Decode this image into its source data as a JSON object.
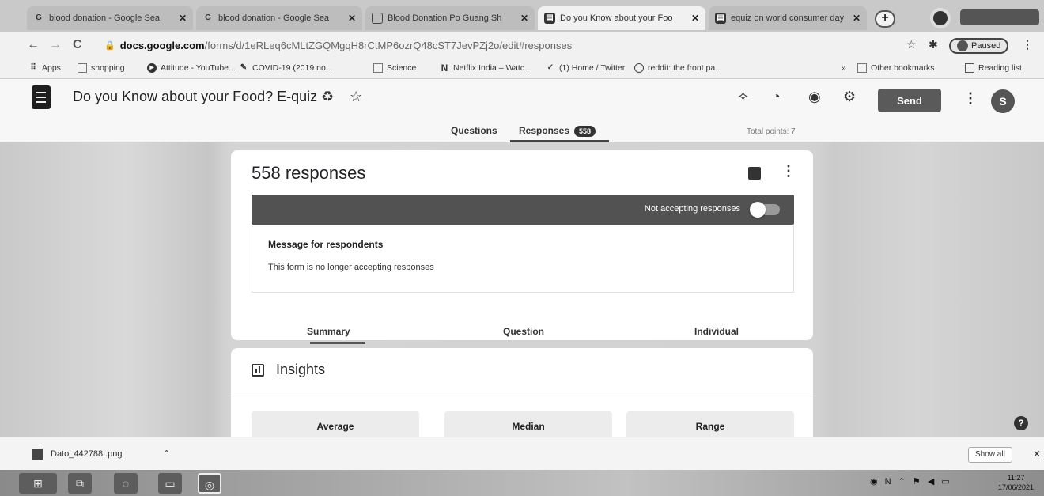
{
  "browser": {
    "tabs": [
      {
        "title": "blood donation - Google Sea",
        "favicon": "google-g",
        "active": false
      },
      {
        "title": "blood donation - Google Sea",
        "favicon": "google-g",
        "active": false
      },
      {
        "title": "Blood Donation Po Guang Sh",
        "favicon": "page-icon",
        "active": false
      },
      {
        "title": "Do you Know about your Foo",
        "favicon": "forms-icon",
        "active": true
      },
      {
        "title": "equiz on world consumer day",
        "favicon": "forms-icon",
        "active": false
      }
    ],
    "url_host": "docs.google.com",
    "url_path": "/forms/d/1eRLeq6cMLtZGQMgqH8rCtMP6ozrQ48cST7JevPZj2o/edit#responses",
    "profile_status": "Paused",
    "bookmarks": [
      {
        "label": "Apps",
        "icon": "apps-grid-icon"
      },
      {
        "label": "shopping",
        "icon": "folder-icon"
      },
      {
        "label": "Attitude - YouTube...",
        "icon": "youtube-icon"
      },
      {
        "label": "COVID-19 (2019 no...",
        "icon": "covid-icon"
      },
      {
        "label": "Science",
        "icon": "folder-icon"
      },
      {
        "label": "Netflix India – Watc...",
        "icon": "netflix-icon"
      },
      {
        "label": "(1) Home / Twitter",
        "icon": "twitter-icon"
      },
      {
        "label": "reddit: the front pa...",
        "icon": "reddit-icon"
      }
    ],
    "other_bookmarks": "Other bookmarks",
    "reading_list": "Reading list"
  },
  "form": {
    "title": "Do you Know about your Food? E-quiz",
    "send_label": "Send",
    "avatar_letter": "S",
    "tabs": {
      "questions": "Questions",
      "responses": "Responses",
      "responses_count": "558"
    },
    "total_points": "Total points: 7"
  },
  "responses": {
    "heading": "558 responses",
    "accepting_label": "Not accepting responses",
    "message_heading": "Message for respondents",
    "message_text": "This form is no longer accepting responses",
    "subtabs": {
      "summary": "Summary",
      "question": "Question",
      "individual": "Individual"
    }
  },
  "insights": {
    "title": "Insights",
    "stats": [
      "Average",
      "Median",
      "Range"
    ]
  },
  "downloads": {
    "file_name": "Dato_442788I.png",
    "show_all": "Show all"
  },
  "taskbar": {
    "time": "11:27",
    "date": "17/06/2021"
  }
}
